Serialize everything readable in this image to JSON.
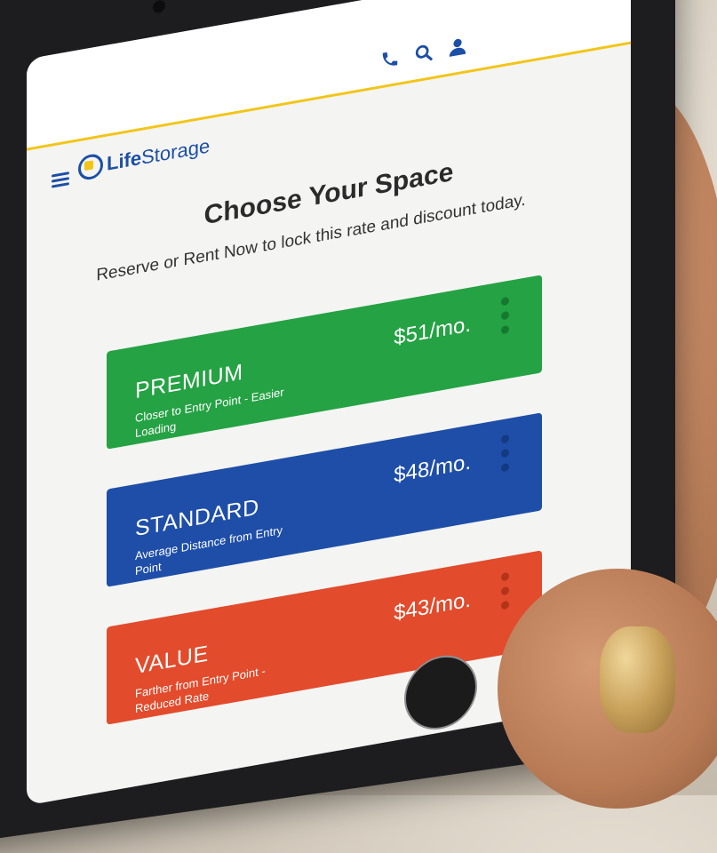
{
  "header": {
    "logo_life": "Life",
    "logo_storage": "Storage",
    "icons": [
      "phone-icon",
      "search-icon",
      "user-icon"
    ]
  },
  "main": {
    "title": "Choose Your Space",
    "subtitle": "Reserve or Rent Now to lock this rate and discount today."
  },
  "units": [
    {
      "name": "PREMIUM",
      "description": "Closer to Entry Point - Easier Loading",
      "price": "$51/mo.",
      "color": "#25a244"
    },
    {
      "name": "STANDARD",
      "description": "Average Distance from Entry Point",
      "price": "$48/mo.",
      "color": "#1e4ea8"
    },
    {
      "name": "VALUE",
      "description": "Farther from Entry Point - Reduced Rate",
      "price": "$43/mo.",
      "color": "#e24b2c"
    }
  ],
  "colors": {
    "brand_blue": "#1c4fa6",
    "brand_yellow": "#f2c518"
  }
}
